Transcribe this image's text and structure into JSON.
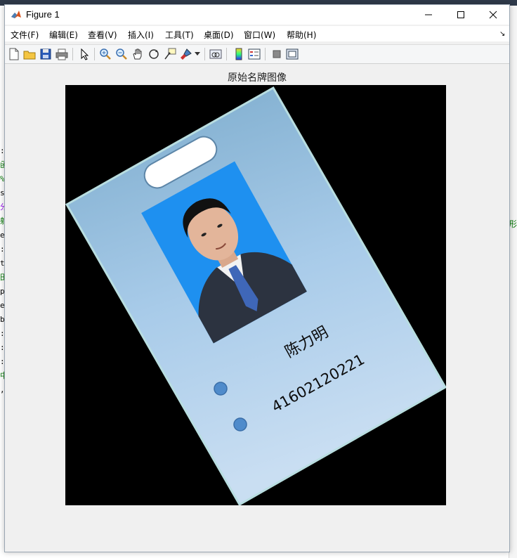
{
  "window": {
    "title": "Figure 1"
  },
  "menu": [
    {
      "label": "文件(F)"
    },
    {
      "label": "编辑(E)"
    },
    {
      "label": "查看(V)"
    },
    {
      "label": "插入(I)"
    },
    {
      "label": "工具(T)"
    },
    {
      "label": "桌面(D)"
    },
    {
      "label": "窗口(W)"
    },
    {
      "label": "帮助(H)"
    }
  ],
  "toolbar": [
    {
      "icon": "new-figure-icon"
    },
    {
      "icon": "open-file-icon"
    },
    {
      "icon": "save-icon"
    },
    {
      "icon": "print-icon"
    },
    {
      "icon": "select-arrow-icon"
    },
    {
      "icon": "zoom-in-icon"
    },
    {
      "icon": "zoom-out-icon"
    },
    {
      "icon": "pan-hand-icon"
    },
    {
      "icon": "rotate-3d-icon"
    },
    {
      "icon": "data-cursor-icon"
    },
    {
      "icon": "brush-icon"
    },
    {
      "icon": "link-plot-icon"
    },
    {
      "icon": "colorbar-icon"
    },
    {
      "icon": "legend-icon"
    },
    {
      "icon": "hide-plot-tools-icon"
    },
    {
      "icon": "show-plot-tools-icon"
    }
  ],
  "axes": {
    "title": "原始名牌图像"
  },
  "badge": {
    "name": "陈力明",
    "id_number": "41602120221"
  },
  "background_editor": {
    "left_chars": [
      ":",
      "",
      "函",
      "%",
      "s",
      "分",
      "射",
      "",
      "",
      "",
      "",
      "e",
      ":",
      "",
      "t",
      "田",
      "p",
      "e",
      "b",
      ":",
      ":",
      ":",
      "中",
      ",",
      ""
    ],
    "right_text": "形"
  },
  "colors": {
    "badge_blue": "#a9c9e8",
    "photo_bg": "#1e90f0",
    "figure_bg": "#f0f0f0"
  }
}
